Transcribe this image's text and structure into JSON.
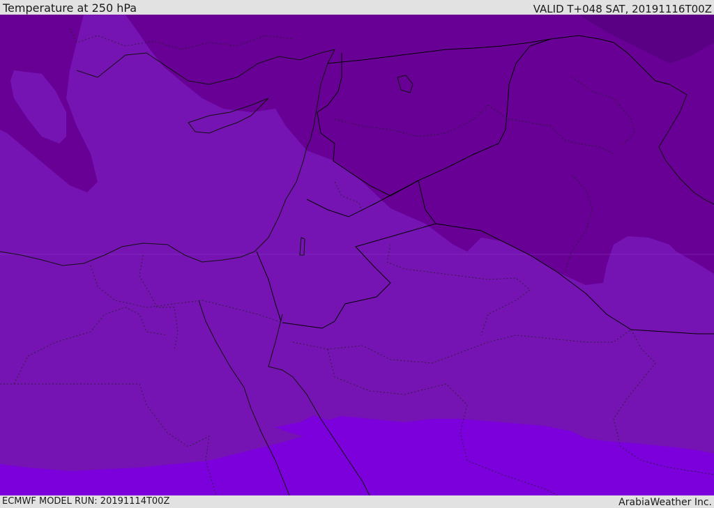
{
  "header": {
    "title": "Temperature at 250 hPa",
    "valid": "VALID T+048 SAT, 20191116T00Z"
  },
  "footer": {
    "model_run": "ECMWF MODEL RUN: 20191114T00Z",
    "credit": "ArabiaWeather Inc."
  },
  "colors": {
    "cold_dark": "#5a0084",
    "cold": "#680096",
    "base": "#7613b3",
    "warm": "#7b00dc",
    "chrome": "#e2e2e2"
  }
}
